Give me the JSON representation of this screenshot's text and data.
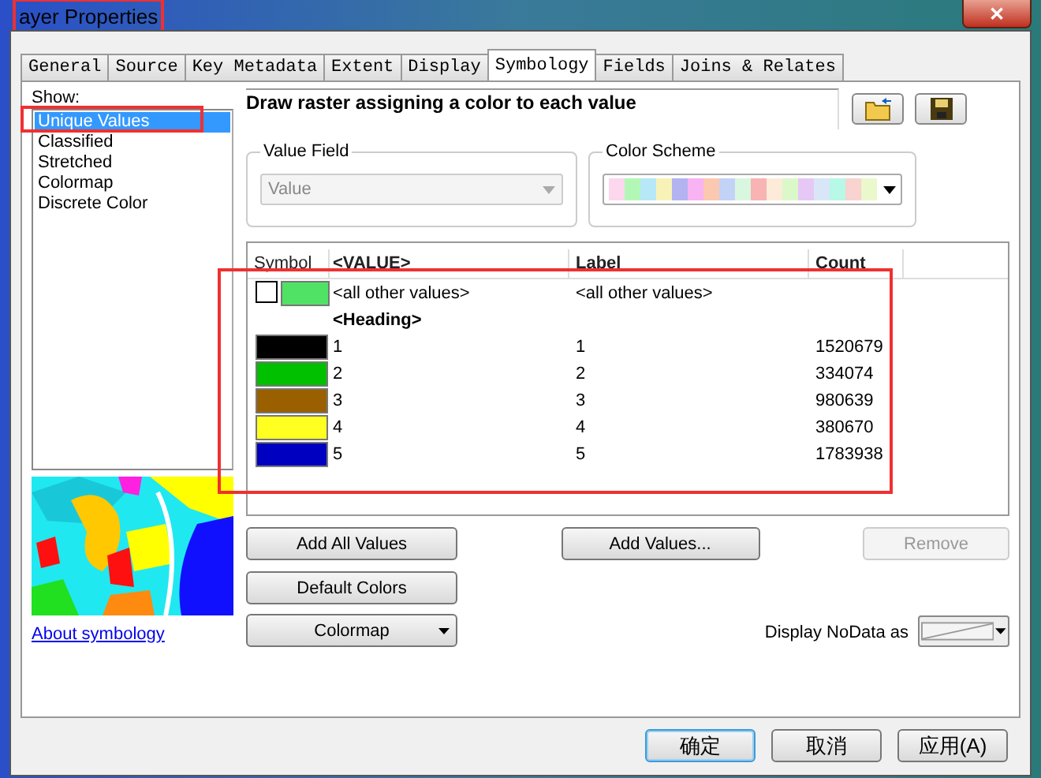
{
  "window": {
    "title": "ayer Properties",
    "close": "✕"
  },
  "tabs": [
    {
      "label": "General",
      "selected": false
    },
    {
      "label": "Source",
      "selected": false
    },
    {
      "label": "Key Metadata",
      "selected": false
    },
    {
      "label": "Extent",
      "selected": false
    },
    {
      "label": "Display",
      "selected": false
    },
    {
      "label": "Symbology",
      "selected": true
    },
    {
      "label": "Fields",
      "selected": false
    },
    {
      "label": "Joins & Relates",
      "selected": false
    }
  ],
  "show": {
    "label": "Show:",
    "items": [
      {
        "label": "Unique Values",
        "selected": true
      },
      {
        "label": "Classified",
        "selected": false
      },
      {
        "label": "Stretched",
        "selected": false
      },
      {
        "label": "Colormap",
        "selected": false
      },
      {
        "label": "Discrete Color",
        "selected": false
      }
    ]
  },
  "about_link": "About symbology",
  "description": "Draw raster assigning a color to each value",
  "value_field": {
    "label": "Value Field",
    "value": "Value",
    "disabled": true
  },
  "color_scheme": {
    "label": "Color Scheme",
    "swatches": [
      {
        "color": "#fcd7ee"
      },
      {
        "color": "#b3f7b7"
      },
      {
        "color": "#b7e8f8"
      },
      {
        "color": "#f8f2b7"
      },
      {
        "color": "#b3b3f2"
      },
      {
        "color": "#f7b3f2"
      },
      {
        "color": "#fbc8b0"
      },
      {
        "color": "#c3d2f7"
      },
      {
        "color": "#d9f7de"
      },
      {
        "color": "#f8b3b3"
      },
      {
        "color": "#fbebd8"
      },
      {
        "color": "#dbf8c8"
      },
      {
        "color": "#e6c8f7"
      },
      {
        "color": "#d8e6f8"
      },
      {
        "color": "#b7f8e6"
      },
      {
        "color": "#f8d3d0"
      },
      {
        "color": "#eaf8cc"
      }
    ]
  },
  "table": {
    "columns": [
      "Symbol",
      "<VALUE>",
      "Label",
      "Count"
    ],
    "rows": [
      {
        "kind": "other",
        "color": "#50e264",
        "value": "<all other values>",
        "label": "<all other values>"
      },
      {
        "kind": "heading",
        "value": "<Heading>"
      },
      {
        "kind": "value",
        "color": "#000000",
        "value": "1",
        "label": "1",
        "count": "1520679"
      },
      {
        "kind": "value",
        "color": "#00c000",
        "value": "2",
        "label": "2",
        "count": "334074"
      },
      {
        "kind": "value",
        "color": "#9a6000",
        "value": "3",
        "label": "3",
        "count": "980639"
      },
      {
        "kind": "value",
        "color": "#ffff20",
        "value": "4",
        "label": "4",
        "count": "380670"
      },
      {
        "kind": "value",
        "color": "#0000c0",
        "value": "5",
        "label": "5",
        "count": "1783938"
      }
    ]
  },
  "buttons": [
    {
      "label": "Add All Values",
      "disabled": false
    },
    {
      "label": "Add Values...",
      "disabled": false
    },
    {
      "label": "Remove",
      "disabled": true
    },
    {
      "label": "Default Colors",
      "disabled": false
    }
  ],
  "colormap_button": "Colormap",
  "nodata_label": "Display NoData as",
  "dialog_buttons": [
    {
      "label": "确定",
      "default": true
    },
    {
      "label": "取消",
      "default": false
    },
    {
      "label": "应用(A)",
      "default": false
    }
  ]
}
